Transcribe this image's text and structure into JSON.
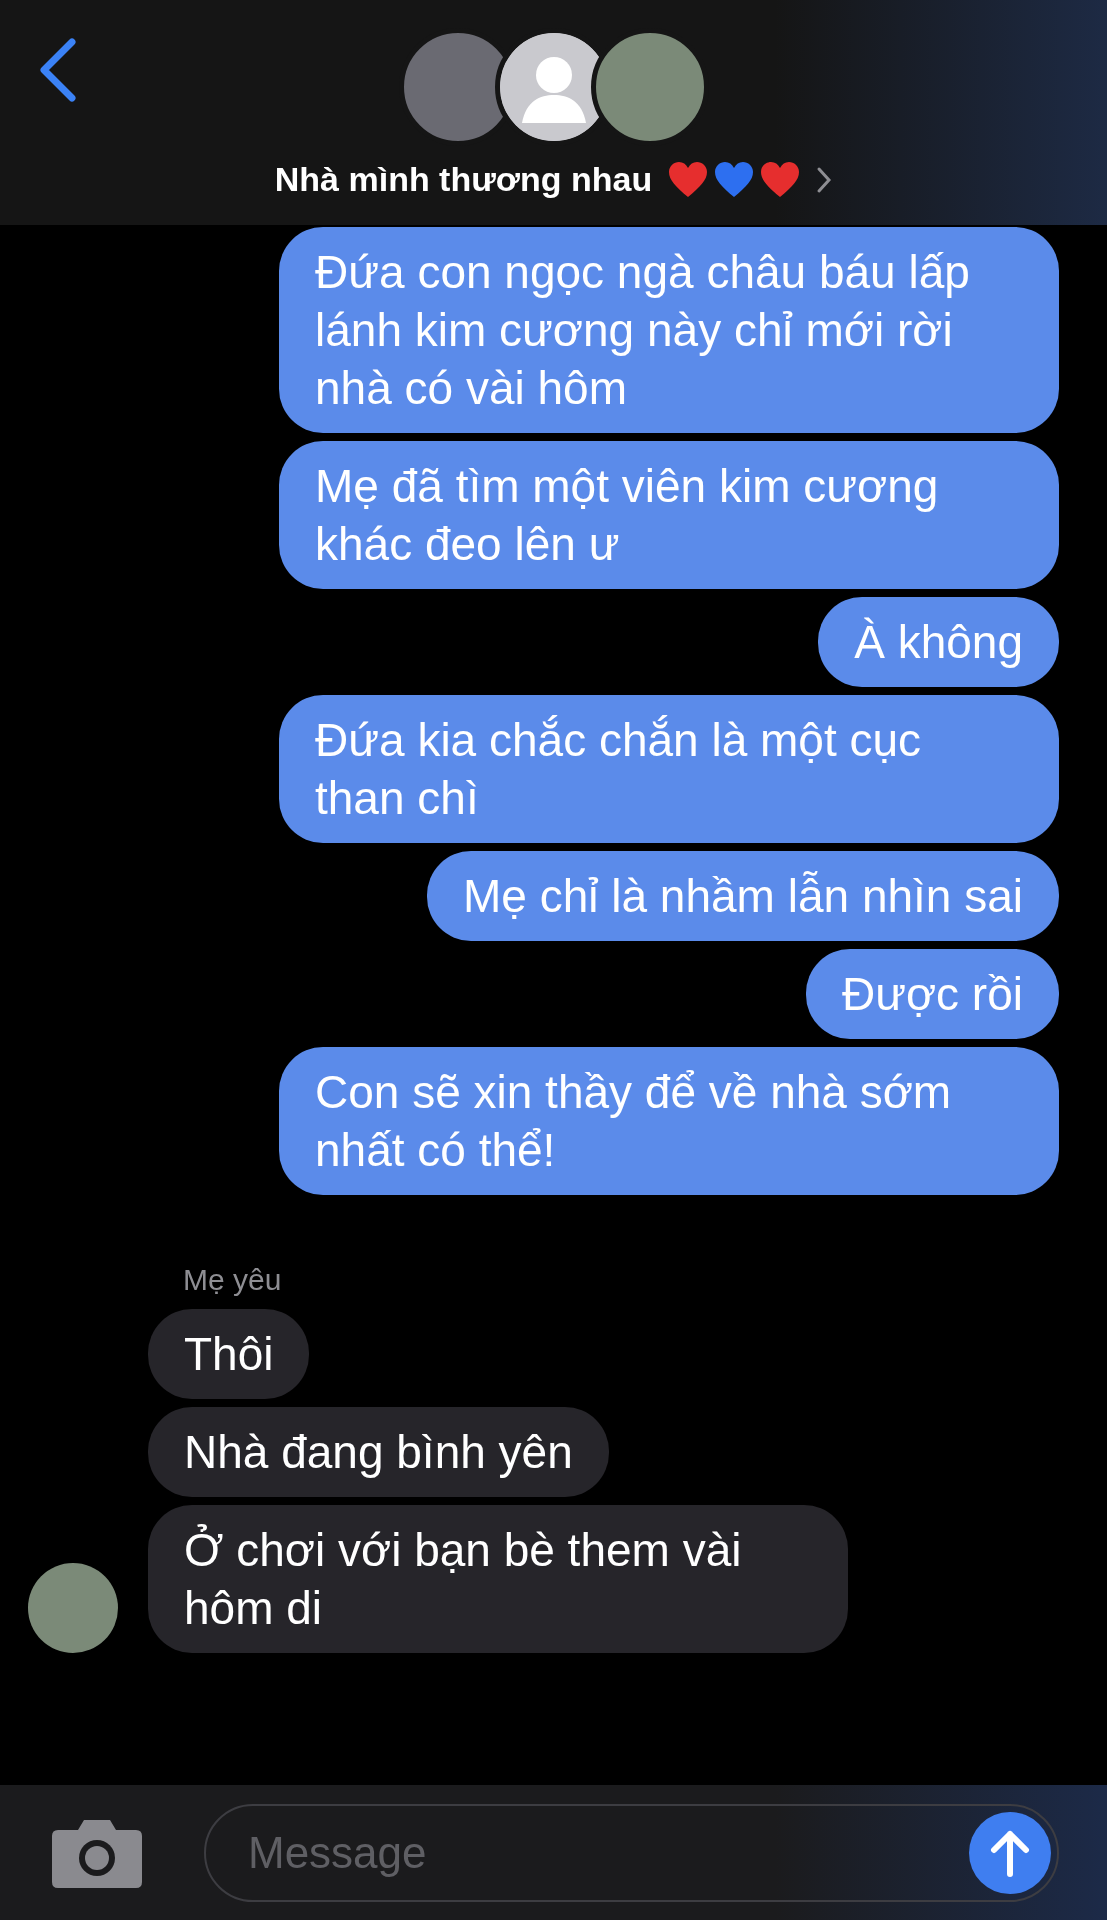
{
  "header": {
    "avatars": [
      {
        "kind": "photo"
      },
      {
        "kind": "silhouette"
      },
      {
        "kind": "photo"
      }
    ],
    "title": "Nhà mình thương nhau",
    "title_hearts": [
      {
        "color": "#e62e2e"
      },
      {
        "color": "#2d6ff0"
      },
      {
        "color": "#e62e2e"
      }
    ]
  },
  "messages": [
    {
      "kind": "sent",
      "text": "Đứa con ngọc ngà châu báu lấp lánh kim cương này chỉ mới rời nhà có vài hôm"
    },
    {
      "kind": "sent",
      "text": "Mẹ đã tìm một viên kim cương khác đeo lên ư"
    },
    {
      "kind": "sent",
      "text": "À không"
    },
    {
      "kind": "sent",
      "text": "Đứa kia chắc chắn là một cục than chì"
    },
    {
      "kind": "sent",
      "text": "Mẹ chỉ là nhầm lẫn nhìn sai"
    },
    {
      "kind": "sent",
      "text": "Được rồi"
    },
    {
      "kind": "sent",
      "text": "Con sẽ xin thầy để về nhà sớm nhất có thể!"
    },
    {
      "kind": "sender_name",
      "text": "Mẹ yêu"
    },
    {
      "kind": "received",
      "text": "Thôi"
    },
    {
      "kind": "received",
      "text": "Nhà đang bình yên"
    },
    {
      "kind": "received",
      "text": "Ở chơi với bạn bè them vài hôm di"
    }
  ],
  "composer": {
    "placeholder": "Message"
  }
}
